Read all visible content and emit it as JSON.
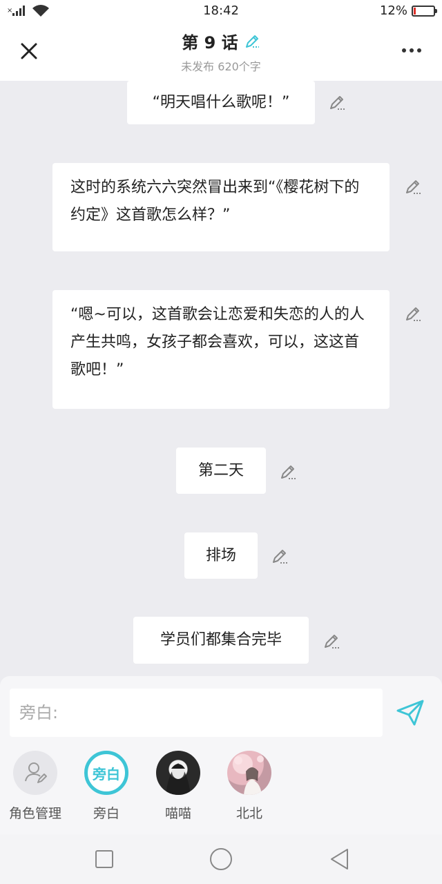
{
  "status_bar": {
    "time": "18:42",
    "battery_percent": "12%",
    "battery_level": 0.12,
    "signal_icon": "signal-icon",
    "wifi_icon": "wifi-icon"
  },
  "header": {
    "title": "第 9 话",
    "subtitle": "未发布 620个字",
    "accent_color": "#3ec5d6"
  },
  "messages": [
    {
      "text": "“明天唱什么歌呢！”"
    },
    {
      "text": "这时的系统六六突然冒出来到“《樱花树下的约定》这首歌怎么样？”"
    },
    {
      "text": "“嗯~可以，这首歌会让恋爱和失恋的人的人产生共鸣，女孩子都会喜欢，可以，这这首歌吧！”"
    },
    {
      "text": "第二天"
    },
    {
      "text": "排场"
    },
    {
      "text": "学员们都集合完毕"
    }
  ],
  "composer": {
    "placeholder": "旁白:"
  },
  "roles": [
    {
      "label": "角色管理",
      "avatar_text": "",
      "icon": "user-edit-icon"
    },
    {
      "label": "旁白",
      "avatar_text": "旁白",
      "selected": true
    },
    {
      "label": "喵喵",
      "avatar_text": ""
    },
    {
      "label": "北北",
      "avatar_text": ""
    }
  ]
}
